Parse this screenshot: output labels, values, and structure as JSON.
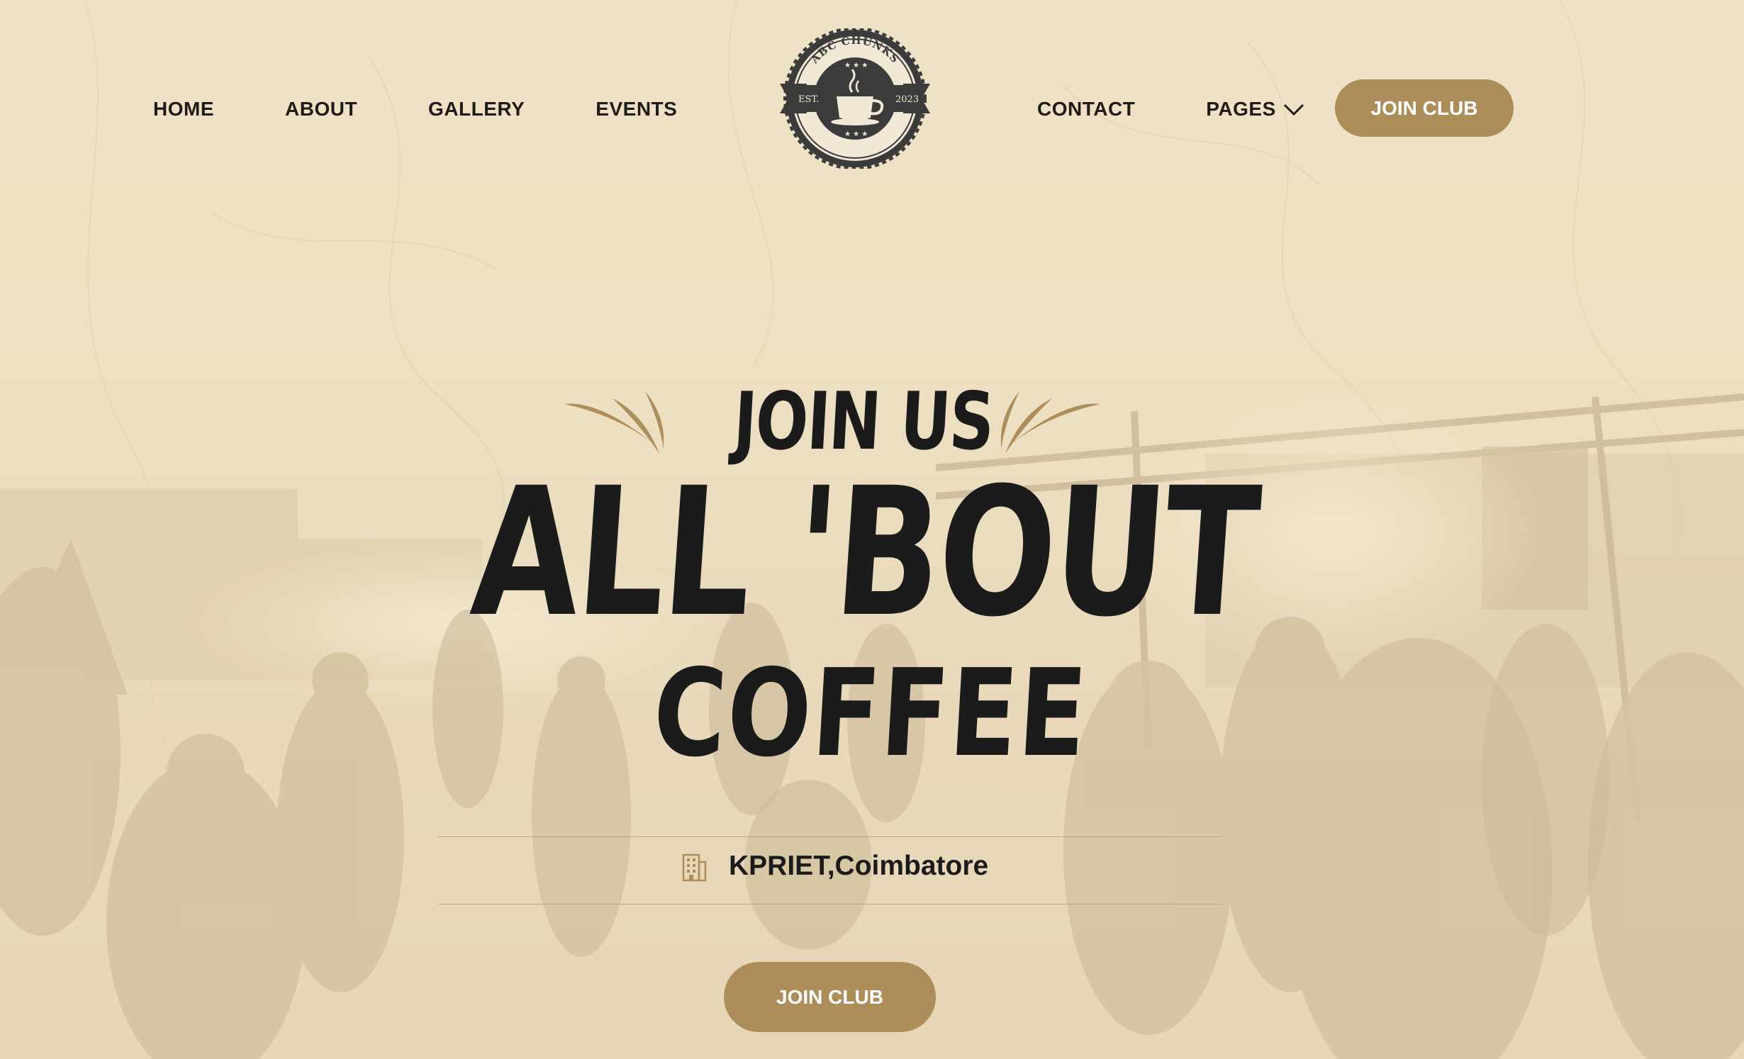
{
  "nav": {
    "left": [
      "HOME",
      "ABOUT",
      "GALLERY",
      "EVENTS"
    ],
    "right": [
      "CONTACT",
      "PAGES"
    ],
    "join_label": "JOIN CLUB",
    "pages_icon": "chevron-down-icon"
  },
  "logo": {
    "name": "ABC CHUNKS",
    "est": "EST.",
    "year": "2023",
    "icon": "coffee-cup-icon"
  },
  "hero": {
    "kicker": "JOIN US",
    "title_line1": "ALL 'BOUT",
    "title_line2": "COFFEE",
    "location_icon": "building-icon",
    "location": "KPRIET,Coimbatore",
    "cta_label": "JOIN CLUB"
  },
  "colors": {
    "accent": "#ad8d59",
    "background": "#ecdfc3",
    "text": "#1b1b1b"
  }
}
